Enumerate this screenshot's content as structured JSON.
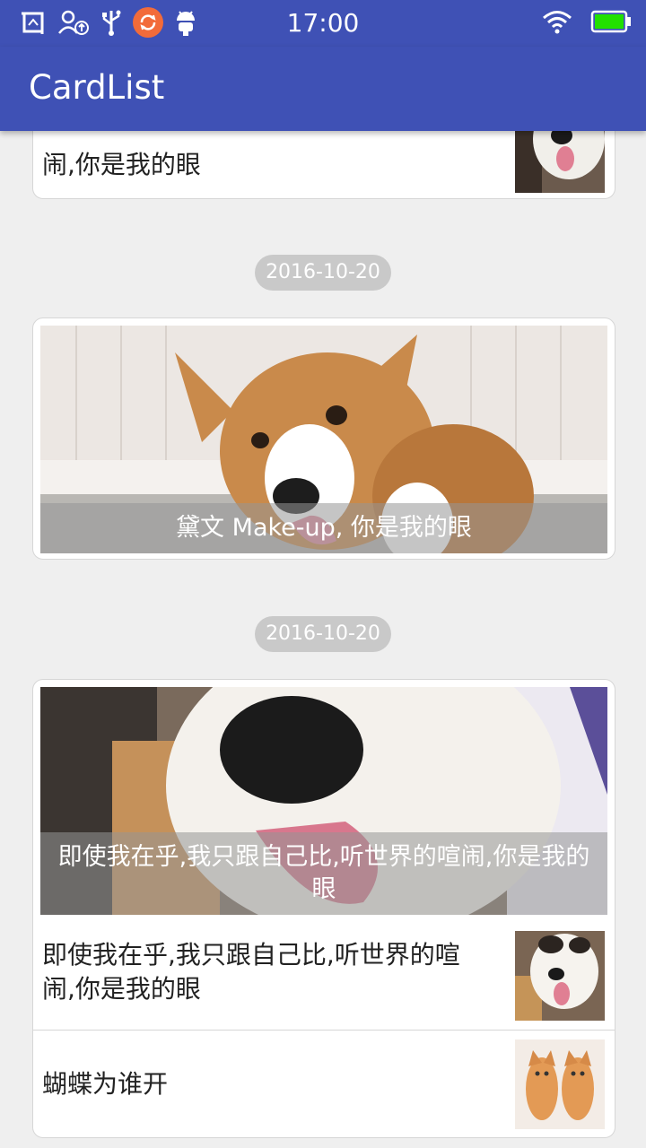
{
  "status": {
    "time": "17:00"
  },
  "app": {
    "title": "CardList"
  },
  "cards": [
    {
      "row_text": "闹,你是我的眼"
    },
    {
      "date": "2016-10-20",
      "caption": "黛文 Make-up, 你是我的眼"
    },
    {
      "date": "2016-10-20",
      "caption": "即使我在乎,我只跟自己比,听世界的喧闹,你是我的眼",
      "rows": [
        {
          "text": "即使我在乎,我只跟自己比,听世界的喧闹,你是我的眼"
        },
        {
          "text": "蝴蝶为谁开"
        }
      ]
    }
  ],
  "colors": {
    "primary": "#3F51B5",
    "background": "#EFEFEF",
    "pill": "#C9C9C9"
  }
}
